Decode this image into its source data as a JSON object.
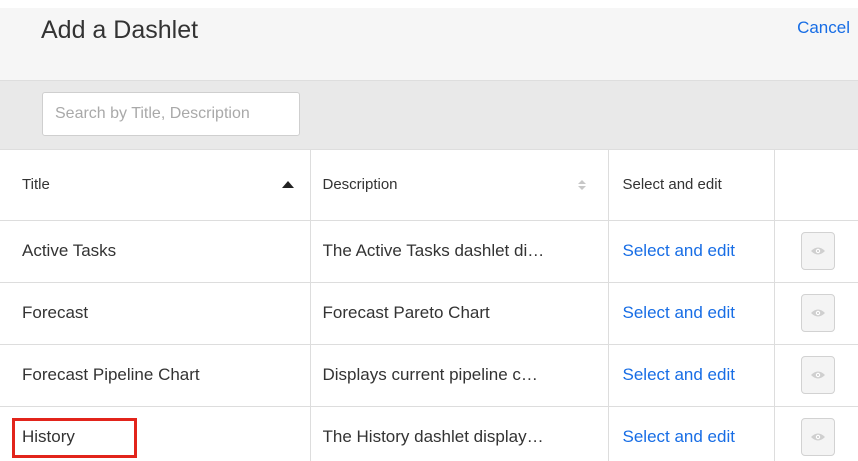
{
  "dialog": {
    "title": "Add a Dashlet",
    "cancel_label": "Cancel"
  },
  "search": {
    "placeholder": "Search by Title, Description",
    "value": ""
  },
  "table": {
    "columns": {
      "title": "Title",
      "description": "Description",
      "select": "Select and edit"
    },
    "rows": [
      {
        "title": "Active Tasks",
        "description": "The Active Tasks dashlet di…",
        "action": "Select and edit"
      },
      {
        "title": "Forecast",
        "description": "Forecast Pareto Chart",
        "action": "Select and edit"
      },
      {
        "title": "Forecast Pipeline Chart",
        "description": "Displays current pipeline c…",
        "action": "Select and edit"
      },
      {
        "title": "History",
        "description": "The History dashlet display…",
        "action": "Select and edit"
      }
    ]
  },
  "icons": {
    "sort_title": "sort-ascending-icon",
    "sort_description": "sort-both-icon",
    "preview": "eye-icon"
  },
  "colors": {
    "link": "#176de5",
    "highlight": "#e2241b"
  }
}
